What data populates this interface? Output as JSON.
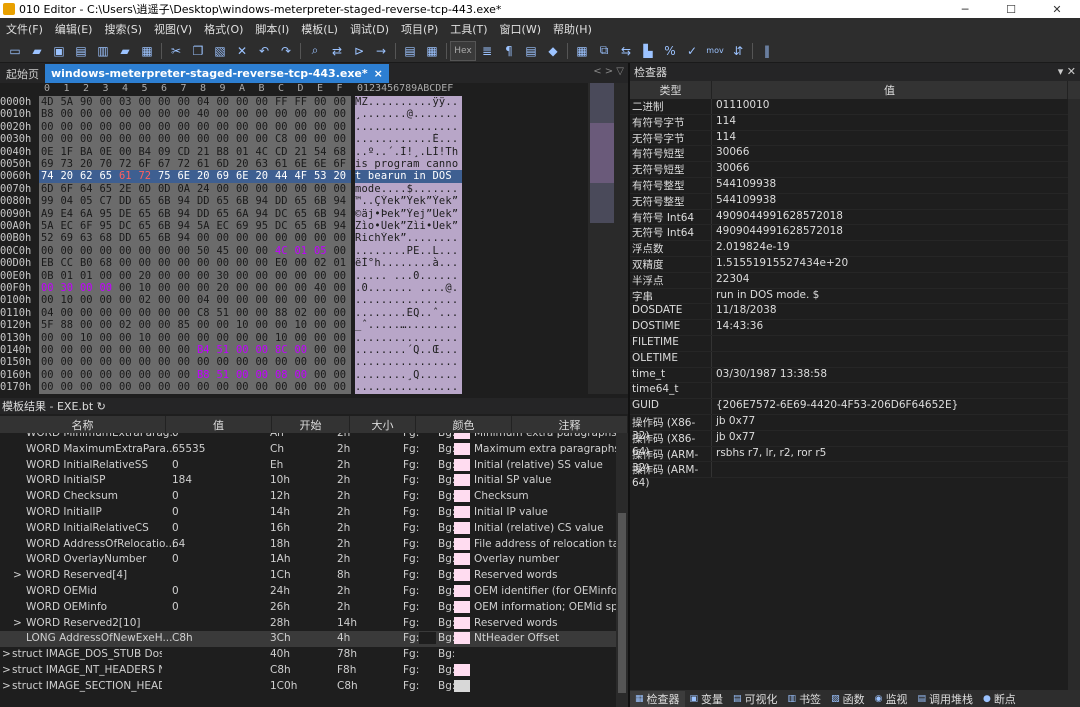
{
  "window": {
    "title": "010 Editor - C:\\Users\\逍遥子\\Desktop\\windows-meterpreter-staged-reverse-tcp-443.exe*",
    "min": "─",
    "max": "☐",
    "close": "✕"
  },
  "menu": [
    "文件(F)",
    "编辑(E)",
    "搜索(S)",
    "视图(V)",
    "格式(O)",
    "脚本(I)",
    "模板(L)",
    "调试(D)",
    "项目(P)",
    "工具(T)",
    "窗口(W)",
    "帮助(H)"
  ],
  "toolbar": {
    "hex_label": "Hex",
    "mov_label": "mov"
  },
  "tabs": {
    "start": "起始页",
    "active": "windows-meterpreter-staged-reverse-tcp-443.exe*",
    "close": "×",
    "nav": "< > ▽"
  },
  "hex": {
    "col_headers": [
      "0",
      "1",
      "2",
      "3",
      "4",
      "5",
      "6",
      "7",
      "8",
      "9",
      "A",
      "B",
      "C",
      "D",
      "E",
      "F"
    ],
    "ascii_header": "0123456789ABCDEF",
    "rows": [
      {
        "addr": "0000h",
        "bytes": [
          "4D",
          "5A",
          "90",
          "00",
          "03",
          "00",
          "00",
          "00",
          "04",
          "00",
          "00",
          "00",
          "FF",
          "FF",
          "00",
          "00"
        ],
        "ascii": "MZ..........ÿÿ.."
      },
      {
        "addr": "0010h",
        "bytes": [
          "B8",
          "00",
          "00",
          "00",
          "00",
          "00",
          "00",
          "00",
          "40",
          "00",
          "00",
          "00",
          "00",
          "00",
          "00",
          "00"
        ],
        "ascii": "¸.......@......."
      },
      {
        "addr": "0020h",
        "bytes": [
          "00",
          "00",
          "00",
          "00",
          "00",
          "00",
          "00",
          "00",
          "00",
          "00",
          "00",
          "00",
          "00",
          "00",
          "00",
          "00"
        ],
        "ascii": "................"
      },
      {
        "addr": "0030h",
        "bytes": [
          "00",
          "00",
          "00",
          "00",
          "00",
          "00",
          "00",
          "00",
          "00",
          "00",
          "00",
          "00",
          "C8",
          "00",
          "00",
          "00"
        ],
        "ascii": "............È..."
      },
      {
        "addr": "0040h",
        "bytes": [
          "0E",
          "1F",
          "BA",
          "0E",
          "00",
          "B4",
          "09",
          "CD",
          "21",
          "B8",
          "01",
          "4C",
          "CD",
          "21",
          "54",
          "68"
        ],
        "ascii": "..º..´.Í!¸.LÍ!Th"
      },
      {
        "addr": "0050h",
        "bytes": [
          "69",
          "73",
          "20",
          "70",
          "72",
          "6F",
          "67",
          "72",
          "61",
          "6D",
          "20",
          "63",
          "61",
          "6E",
          "6E",
          "6F"
        ],
        "ascii": "is program canno"
      },
      {
        "addr": "0060h",
        "bytes": [
          "74",
          "20",
          "62",
          "65",
          "61",
          "72",
          "75",
          "6E",
          "20",
          "69",
          "6E",
          "20",
          "44",
          "4F",
          "53",
          "20"
        ],
        "ascii": "t bearun in DOS "
      },
      {
        "addr": "0070h",
        "bytes": [
          "6D",
          "6F",
          "64",
          "65",
          "2E",
          "0D",
          "0D",
          "0A",
          "24",
          "00",
          "00",
          "00",
          "00",
          "00",
          "00",
          "00"
        ],
        "ascii": "mode....$......."
      },
      {
        "addr": "0080h",
        "bytes": [
          "99",
          "04",
          "05",
          "C7",
          "DD",
          "65",
          "6B",
          "94",
          "DD",
          "65",
          "6B",
          "94",
          "DD",
          "65",
          "6B",
          "94"
        ],
        "ascii": "™..ÇÝek”Ýek”Ýek”"
      },
      {
        "addr": "0090h",
        "bytes": [
          "A9",
          "E4",
          "6A",
          "95",
          "DE",
          "65",
          "6B",
          "94",
          "DD",
          "65",
          "6A",
          "94",
          "DC",
          "65",
          "6B",
          "94"
        ],
        "ascii": "©äj•Þek”Ýej”Üek”"
      },
      {
        "addr": "00A0h",
        "bytes": [
          "5A",
          "EC",
          "6F",
          "95",
          "DC",
          "65",
          "6B",
          "94",
          "5A",
          "EC",
          "69",
          "95",
          "DC",
          "65",
          "6B",
          "94"
        ],
        "ascii": "Zìo•Üek”Zìi•Üek”"
      },
      {
        "addr": "00B0h",
        "bytes": [
          "52",
          "69",
          "63",
          "68",
          "DD",
          "65",
          "6B",
          "94",
          "00",
          "00",
          "00",
          "00",
          "00",
          "00",
          "00",
          "00"
        ],
        "ascii": "RichÝek”........"
      },
      {
        "addr": "00C0h",
        "bytes": [
          "00",
          "00",
          "00",
          "00",
          "00",
          "00",
          "00",
          "00",
          "50",
          "45",
          "00",
          "00",
          "4C",
          "01",
          "05",
          "00"
        ],
        "ascii": "........PE..L..."
      },
      {
        "addr": "00D0h",
        "bytes": [
          "EB",
          "CC",
          "B0",
          "68",
          "00",
          "00",
          "00",
          "00",
          "00",
          "00",
          "00",
          "00",
          "E0",
          "00",
          "02",
          "01"
        ],
        "ascii": "ëÌ°h........à..."
      },
      {
        "addr": "00E0h",
        "bytes": [
          "0B",
          "01",
          "01",
          "00",
          "00",
          "20",
          "00",
          "00",
          "00",
          "30",
          "00",
          "00",
          "00",
          "00",
          "00",
          "00"
        ],
        "ascii": "..... ...0......"
      },
      {
        "addr": "00F0h",
        "bytes": [
          "00",
          "30",
          "00",
          "00",
          "00",
          "10",
          "00",
          "00",
          "00",
          "20",
          "00",
          "00",
          "00",
          "00",
          "40",
          "00"
        ],
        "ascii": ".0....... ....@."
      },
      {
        "addr": "0100h",
        "bytes": [
          "00",
          "10",
          "00",
          "00",
          "00",
          "02",
          "00",
          "00",
          "04",
          "00",
          "00",
          "00",
          "00",
          "00",
          "00",
          "00"
        ],
        "ascii": "................"
      },
      {
        "addr": "0110h",
        "bytes": [
          "04",
          "00",
          "00",
          "00",
          "00",
          "00",
          "00",
          "00",
          "C8",
          "51",
          "00",
          "00",
          "88",
          "02",
          "00",
          "00"
        ],
        "ascii": "........ÈQ..ˆ..."
      },
      {
        "addr": "0120h",
        "bytes": [
          "5F",
          "88",
          "00",
          "00",
          "02",
          "00",
          "00",
          "85",
          "00",
          "00",
          "10",
          "00",
          "00",
          "10",
          "00",
          "00"
        ],
        "ascii": "_ˆ.....…........"
      },
      {
        "addr": "0130h",
        "bytes": [
          "00",
          "00",
          "10",
          "00",
          "00",
          "10",
          "00",
          "00",
          "00",
          "00",
          "00",
          "00",
          "10",
          "00",
          "00",
          "00"
        ],
        "ascii": "................"
      },
      {
        "addr": "0140h",
        "bytes": [
          "00",
          "00",
          "00",
          "00",
          "00",
          "00",
          "00",
          "00",
          "B4",
          "51",
          "00",
          "00",
          "8C",
          "00",
          "00",
          "00"
        ],
        "ascii": "........´Q..Œ..."
      },
      {
        "addr": "0150h",
        "bytes": [
          "00",
          "00",
          "00",
          "00",
          "00",
          "00",
          "00",
          "00",
          "00",
          "00",
          "00",
          "00",
          "00",
          "00",
          "00",
          "00"
        ],
        "ascii": "................"
      },
      {
        "addr": "0160h",
        "bytes": [
          "00",
          "00",
          "00",
          "00",
          "00",
          "00",
          "00",
          "00",
          "B8",
          "51",
          "00",
          "00",
          "08",
          "00",
          "00",
          "00"
        ],
        "ascii": "........¸Q......"
      },
      {
        "addr": "0170h",
        "bytes": [
          "00",
          "00",
          "00",
          "00",
          "00",
          "00",
          "00",
          "00",
          "00",
          "00",
          "00",
          "00",
          "00",
          "00",
          "00",
          "00"
        ],
        "ascii": "................"
      }
    ]
  },
  "template": {
    "header": "模板结果 - EXE.bt ↻",
    "columns": [
      "名称",
      "值",
      "开始",
      "大小",
      "颜色",
      "注释"
    ],
    "rows": [
      {
        "name": "WORD MinimumExtraParag...",
        "value": "0",
        "start": "Ah",
        "size": "2h",
        "fg": "Fg:",
        "bg": "Bg:",
        "comment": "Minimum extra paragraphs ne",
        "indent": 2,
        "exp": "",
        "hl": false,
        "bgcolor": "#ffdcf0"
      },
      {
        "name": "WORD MaximumExtraPara...",
        "value": "65535",
        "start": "Ch",
        "size": "2h",
        "fg": "Fg:",
        "bg": "Bg:",
        "comment": "Maximum extra paragraphs n",
        "indent": 2,
        "exp": "",
        "hl": false,
        "bgcolor": "#ffdcf0"
      },
      {
        "name": "WORD InitialRelativeSS",
        "value": "0",
        "start": "Eh",
        "size": "2h",
        "fg": "Fg:",
        "bg": "Bg:",
        "comment": "Initial (relative) SS value",
        "indent": 2,
        "exp": "",
        "hl": false,
        "bgcolor": "#ffdcf0"
      },
      {
        "name": "WORD InitialSP",
        "value": "184",
        "start": "10h",
        "size": "2h",
        "fg": "Fg:",
        "bg": "Bg:",
        "comment": "Initial SP value",
        "indent": 2,
        "exp": "",
        "hl": false,
        "bgcolor": "#ffdcf0"
      },
      {
        "name": "WORD Checksum",
        "value": "0",
        "start": "12h",
        "size": "2h",
        "fg": "Fg:",
        "bg": "Bg:",
        "comment": "Checksum",
        "indent": 2,
        "exp": "",
        "hl": false,
        "bgcolor": "#ffdcf0"
      },
      {
        "name": "WORD InitialIP",
        "value": "0",
        "start": "14h",
        "size": "2h",
        "fg": "Fg:",
        "bg": "Bg:",
        "comment": "Initial IP value",
        "indent": 2,
        "exp": "",
        "hl": false,
        "bgcolor": "#ffdcf0"
      },
      {
        "name": "WORD InitialRelativeCS",
        "value": "0",
        "start": "16h",
        "size": "2h",
        "fg": "Fg:",
        "bg": "Bg:",
        "comment": "Initial (relative) CS value",
        "indent": 2,
        "exp": "",
        "hl": false,
        "bgcolor": "#ffdcf0"
      },
      {
        "name": "WORD AddressOfRelocatio...",
        "value": "64",
        "start": "18h",
        "size": "2h",
        "fg": "Fg:",
        "bg": "Bg:",
        "comment": "File address of relocation tabl",
        "indent": 2,
        "exp": "",
        "hl": false,
        "bgcolor": "#ffdcf0"
      },
      {
        "name": "WORD OverlayNumber",
        "value": "0",
        "start": "1Ah",
        "size": "2h",
        "fg": "Fg:",
        "bg": "Bg:",
        "comment": "Overlay number",
        "indent": 2,
        "exp": "",
        "hl": false,
        "bgcolor": "#ffdcf0"
      },
      {
        "name": "WORD Reserved[4]",
        "value": "",
        "start": "1Ch",
        "size": "8h",
        "fg": "Fg:",
        "bg": "Bg:",
        "comment": "Reserved words",
        "indent": 2,
        "exp": ">",
        "hl": false,
        "bgcolor": "#ffdcf0"
      },
      {
        "name": "WORD OEMid",
        "value": "0",
        "start": "24h",
        "size": "2h",
        "fg": "Fg:",
        "bg": "Bg:",
        "comment": "OEM identifier (for OEMinfo)",
        "indent": 2,
        "exp": "",
        "hl": false,
        "bgcolor": "#ffdcf0"
      },
      {
        "name": "WORD OEMinfo",
        "value": "0",
        "start": "26h",
        "size": "2h",
        "fg": "Fg:",
        "bg": "Bg:",
        "comment": "OEM information; OEMid spec",
        "indent": 2,
        "exp": "",
        "hl": false,
        "bgcolor": "#ffdcf0"
      },
      {
        "name": "WORD Reserved2[10]",
        "value": "",
        "start": "28h",
        "size": "14h",
        "fg": "Fg:",
        "bg": "Bg:",
        "comment": "Reserved words",
        "indent": 2,
        "exp": ">",
        "hl": false,
        "bgcolor": "#ffdcf0"
      },
      {
        "name": "LONG AddressOfNewExeH...",
        "value": "C8h",
        "start": "3Ch",
        "size": "4h",
        "fg": "Fg:",
        "bg": "Bg:",
        "comment": "NtHeader Offset",
        "indent": 2,
        "exp": "",
        "hl": true,
        "bgcolor": "#ffdcf0"
      },
      {
        "name": "struct IMAGE_DOS_STUB DosS...",
        "value": "",
        "start": "40h",
        "size": "78h",
        "fg": "Fg:",
        "bg": "Bg:",
        "comment": "",
        "indent": 1,
        "exp": ">",
        "hl": false,
        "bgcolor": "#1e1e1e"
      },
      {
        "name": "struct IMAGE_NT_HEADERS Nt...",
        "value": "",
        "start": "C8h",
        "size": "F8h",
        "fg": "Fg:",
        "bg": "Bg:",
        "comment": "",
        "indent": 1,
        "exp": ">",
        "hl": false,
        "bgcolor": "#ffdcf0"
      },
      {
        "name": "struct IMAGE_SECTION_HEAD...",
        "value": "",
        "start": "1C0h",
        "size": "C8h",
        "fg": "Fg:",
        "bg": "Bg:",
        "comment": "",
        "indent": 1,
        "exp": ">",
        "hl": false,
        "bgcolor": "#d8d8d8"
      }
    ]
  },
  "inspector": {
    "title": "检查器",
    "close": "▾ ✕",
    "columns": [
      "类型",
      "值"
    ],
    "rows": [
      {
        "k": "二进制",
        "v": "01110010"
      },
      {
        "k": "有符号字节",
        "v": "114"
      },
      {
        "k": "无符号字节",
        "v": "114"
      },
      {
        "k": "有符号短型",
        "v": "30066"
      },
      {
        "k": "无符号短型",
        "v": "30066"
      },
      {
        "k": "有符号整型",
        "v": "544109938"
      },
      {
        "k": "无符号整型",
        "v": "544109938"
      },
      {
        "k": "有符号 Int64",
        "v": "4909044991628572018"
      },
      {
        "k": "无符号 Int64",
        "v": "4909044991628572018"
      },
      {
        "k": "浮点数",
        "v": "2.019824e-19"
      },
      {
        "k": "双精度",
        "v": "1.51551915527434e+20"
      },
      {
        "k": "半浮点",
        "v": "22304"
      },
      {
        "k": "字串",
        "v": "run in DOS mode.  $"
      },
      {
        "k": "DOSDATE",
        "v": "11/18/2038"
      },
      {
        "k": "DOSTIME",
        "v": "14:43:36"
      },
      {
        "k": "FILETIME",
        "v": ""
      },
      {
        "k": "OLETIME",
        "v": ""
      },
      {
        "k": "time_t",
        "v": "03/30/1987 13:38:58"
      },
      {
        "k": "time64_t",
        "v": ""
      },
      {
        "k": "GUID",
        "v": "{206E7572-6E69-4420-4F53-206D6F64652E}"
      },
      {
        "k": "操作码 (X86-32)",
        "v": "jb 0x77"
      },
      {
        "k": "操作码 (X86-64)",
        "v": "jb 0x77"
      },
      {
        "k": "操作码 (ARM-32)",
        "v": "rsbhs r7, lr, r2, ror r5"
      },
      {
        "k": "操作码 (ARM-64)",
        "v": ""
      }
    ]
  },
  "bottom_tabs": [
    "检查器",
    "变量",
    "可视化",
    "书签",
    "函数",
    "监视",
    "调用堆栈",
    "断点"
  ]
}
